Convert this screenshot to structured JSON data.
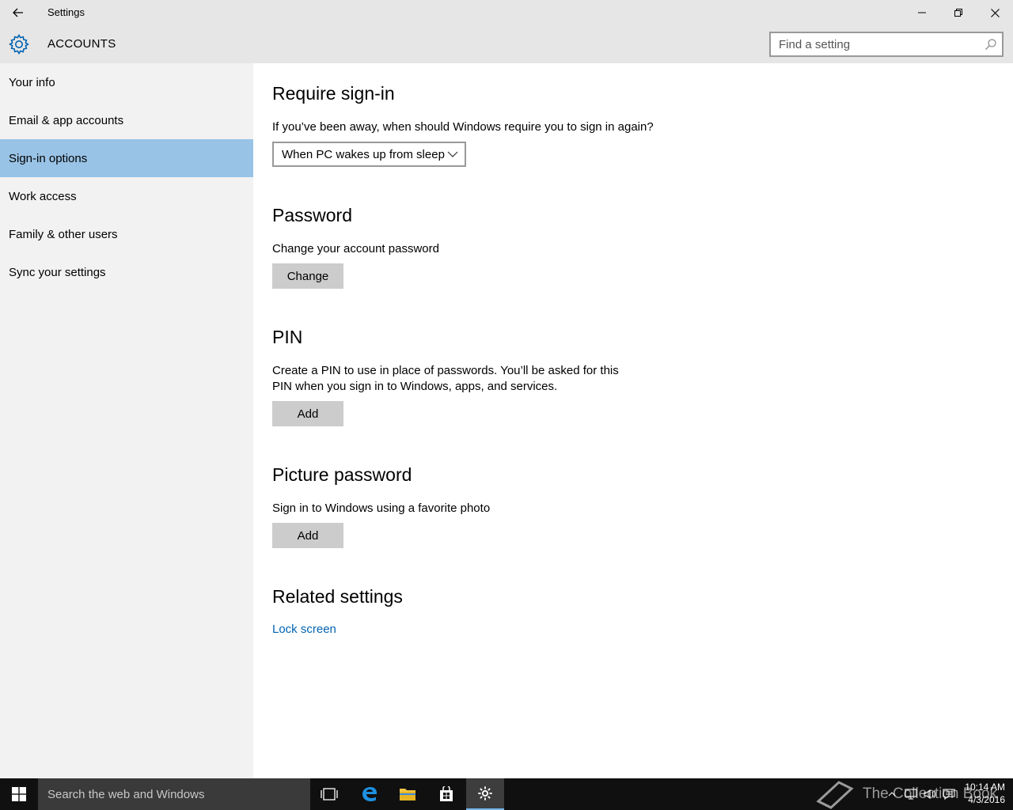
{
  "titlebar": {
    "title": "Settings"
  },
  "header": {
    "section": "ACCOUNTS",
    "search_placeholder": "Find a setting"
  },
  "sidebar": {
    "items": [
      {
        "label": "Your info"
      },
      {
        "label": "Email & app accounts"
      },
      {
        "label": "Sign-in options",
        "selected": true
      },
      {
        "label": "Work access"
      },
      {
        "label": "Family & other users"
      },
      {
        "label": "Sync your settings"
      }
    ]
  },
  "main": {
    "require": {
      "heading": "Require sign-in",
      "question": "If you’ve been away, when should Windows require you to sign in again?",
      "dropdown_value": "When PC wakes up from sleep"
    },
    "password": {
      "heading": "Password",
      "description": "Change your account password",
      "button": "Change"
    },
    "pin": {
      "heading": "PIN",
      "line1": "Create a PIN to use in place of passwords. You’ll be asked for this",
      "line2": "PIN when you sign in to Windows, apps, and services.",
      "button": "Add"
    },
    "picture": {
      "heading": "Picture password",
      "description": "Sign in to Windows using a favorite photo",
      "button": "Add"
    },
    "related": {
      "heading": "Related settings",
      "link": "Lock screen"
    }
  },
  "taskbar": {
    "search_placeholder": "Search the web and Windows",
    "watermark": "The Collection Book",
    "time": "10:14 AM",
    "date": "4/3/2016"
  },
  "colors": {
    "accent": "#0063b1",
    "selection": "#99c3e6",
    "sidebar": "#f2f2f2",
    "chrome": "#e6e6e6",
    "taskbar": "#101010"
  }
}
